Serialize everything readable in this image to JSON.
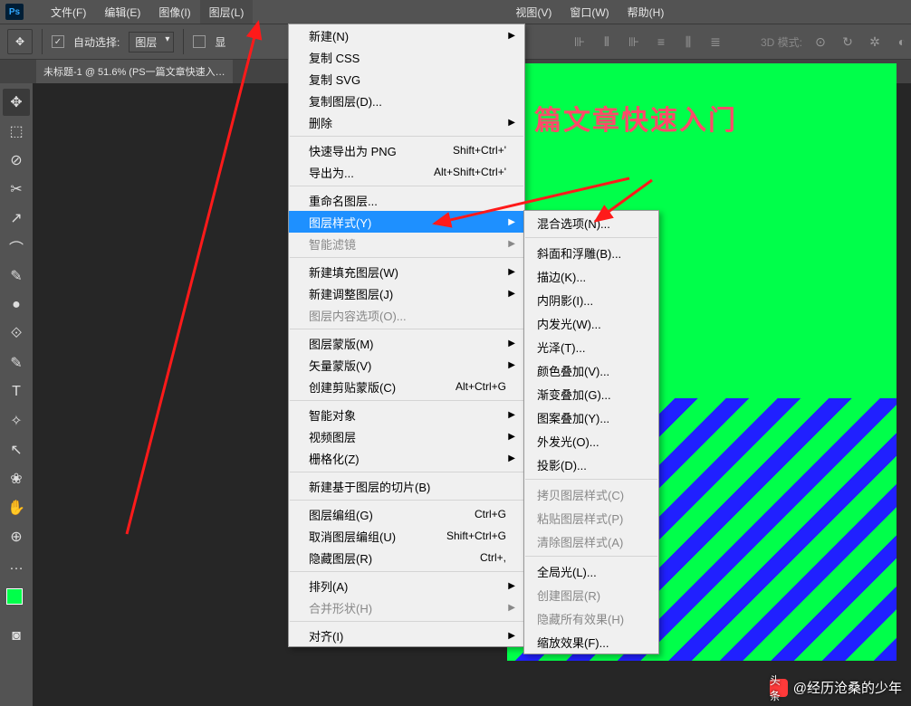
{
  "app_icon": "Ps",
  "menu": [
    "文件(F)",
    "编辑(E)",
    "图像(I)",
    "图层(L)",
    "视图(V)",
    "窗口(W)",
    "帮助(H)"
  ],
  "options": {
    "auto_select": "自动选择:",
    "layer_select": "图层",
    "show_label": "显",
    "mode_3d": "3D 模式:"
  },
  "tab_title": "未标题-1 @ 51.6% (PS一篇文章快速入…",
  "canvas_text": "篇文章快速入门",
  "watermark": "@经历沧桑的少年",
  "layer_menu": [
    {
      "t": "新建(N)",
      "a": true
    },
    {
      "t": "复制 CSS"
    },
    {
      "t": "复制 SVG"
    },
    {
      "t": "复制图层(D)..."
    },
    {
      "t": "删除",
      "a": true
    },
    {
      "sep": true
    },
    {
      "t": "快速导出为 PNG",
      "s": "Shift+Ctrl+'"
    },
    {
      "t": "导出为...",
      "s": "Alt+Shift+Ctrl+'"
    },
    {
      "sep": true
    },
    {
      "t": "重命名图层..."
    },
    {
      "t": "图层样式(Y)",
      "a": true,
      "hl": true
    },
    {
      "t": "智能滤镜",
      "a": true,
      "d": true
    },
    {
      "sep": true
    },
    {
      "t": "新建填充图层(W)",
      "a": true
    },
    {
      "t": "新建调整图层(J)",
      "a": true
    },
    {
      "t": "图层内容选项(O)...",
      "d": true
    },
    {
      "sep": true
    },
    {
      "t": "图层蒙版(M)",
      "a": true
    },
    {
      "t": "矢量蒙版(V)",
      "a": true
    },
    {
      "t": "创建剪贴蒙版(C)",
      "s": "Alt+Ctrl+G"
    },
    {
      "sep": true
    },
    {
      "t": "智能对象",
      "a": true
    },
    {
      "t": "视频图层",
      "a": true
    },
    {
      "t": "栅格化(Z)",
      "a": true
    },
    {
      "sep": true
    },
    {
      "t": "新建基于图层的切片(B)"
    },
    {
      "sep": true
    },
    {
      "t": "图层编组(G)",
      "s": "Ctrl+G"
    },
    {
      "t": "取消图层编组(U)",
      "s": "Shift+Ctrl+G"
    },
    {
      "t": "隐藏图层(R)",
      "s": "Ctrl+,"
    },
    {
      "sep": true
    },
    {
      "t": "排列(A)",
      "a": true
    },
    {
      "t": "合并形状(H)",
      "a": true,
      "d": true
    },
    {
      "sep": true
    },
    {
      "t": "对齐(I)",
      "a": true
    }
  ],
  "style_submenu": [
    {
      "t": "混合选项(N)..."
    },
    {
      "sep": true
    },
    {
      "t": "斜面和浮雕(B)..."
    },
    {
      "t": "描边(K)..."
    },
    {
      "t": "内阴影(I)..."
    },
    {
      "t": "内发光(W)..."
    },
    {
      "t": "光泽(T)..."
    },
    {
      "t": "颜色叠加(V)..."
    },
    {
      "t": "渐变叠加(G)..."
    },
    {
      "t": "图案叠加(Y)..."
    },
    {
      "t": "外发光(O)..."
    },
    {
      "t": "投影(D)..."
    },
    {
      "sep": true
    },
    {
      "t": "拷贝图层样式(C)",
      "d": true
    },
    {
      "t": "粘贴图层样式(P)",
      "d": true
    },
    {
      "t": "清除图层样式(A)",
      "d": true
    },
    {
      "sep": true
    },
    {
      "t": "全局光(L)..."
    },
    {
      "t": "创建图层(R)",
      "d": true
    },
    {
      "t": "隐藏所有效果(H)",
      "d": true
    },
    {
      "t": "缩放效果(F)..."
    }
  ],
  "tools": [
    "✥",
    "⬚",
    "⊘",
    "✂",
    "↗",
    "⌒",
    "✎",
    "●",
    "⟐",
    "✎",
    "T",
    "✧",
    "↖",
    "❀",
    "✋",
    "⊕",
    "…"
  ],
  "watermark_prefix": "头条"
}
